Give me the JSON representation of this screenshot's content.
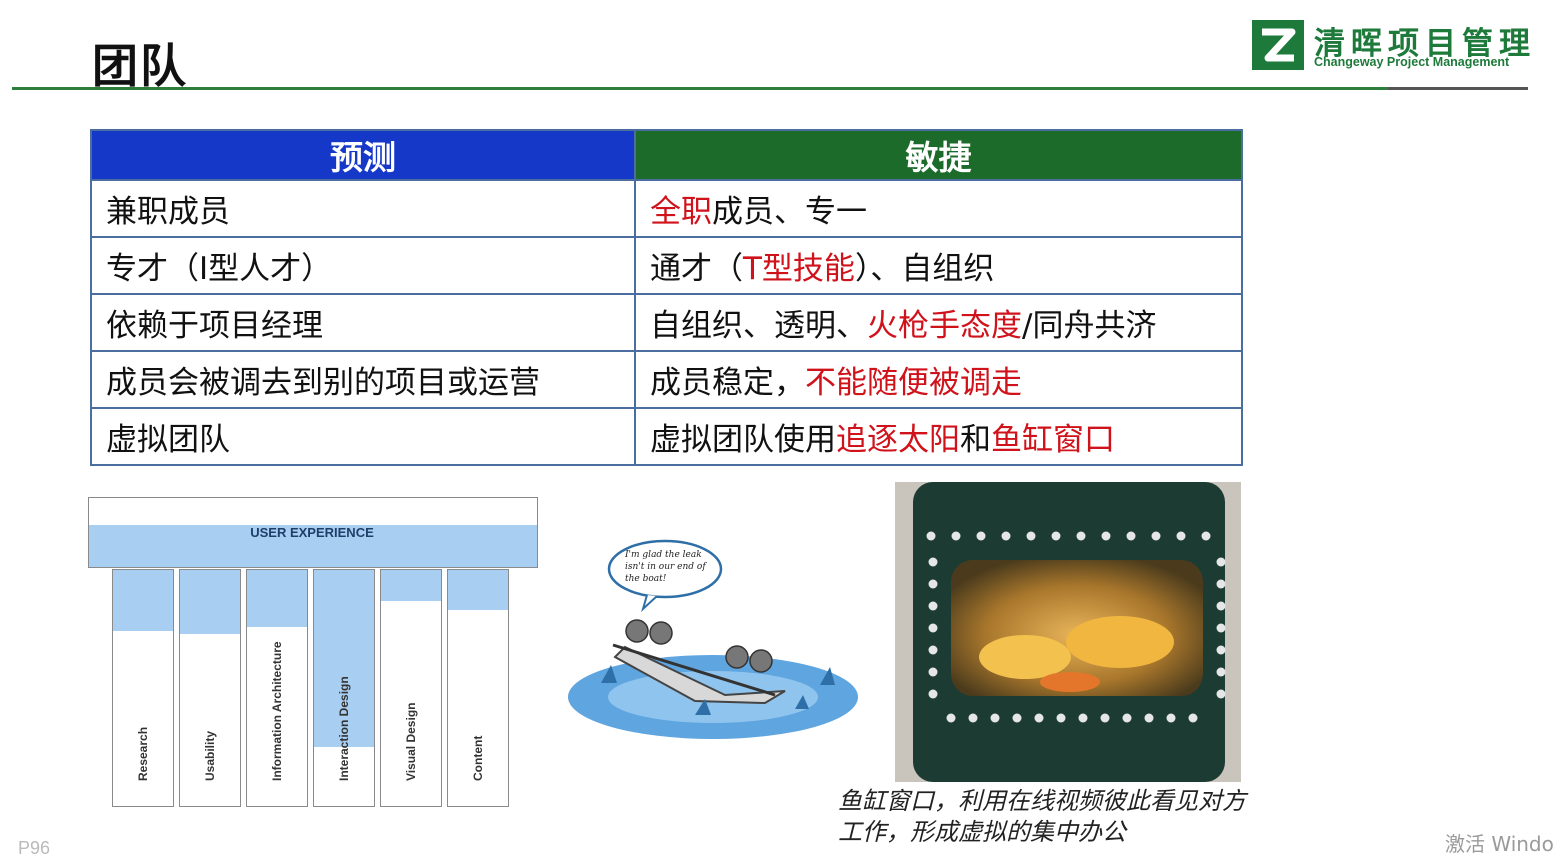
{
  "slide": {
    "title": "团队",
    "page_number": "P96",
    "watermark": "激活 Windo"
  },
  "logo": {
    "name_cn": "清晖项目管理",
    "name_en": "Changeway Project Management",
    "brand_color": "#1d7a3a"
  },
  "table": {
    "headers": [
      "预测",
      "敏捷"
    ],
    "header_colors": [
      "#1538c8",
      "#1d6b2b"
    ],
    "highlight_color": "#d0121b",
    "rows": [
      {
        "predictive": "兼职成员",
        "agile": [
          {
            "text": "全职",
            "highlight": true
          },
          {
            "text": "成员、专一",
            "highlight": false
          }
        ]
      },
      {
        "predictive": "专才（I型人才）",
        "agile": [
          {
            "text": "通才（",
            "highlight": false
          },
          {
            "text": "T型技能",
            "highlight": true
          },
          {
            "text": "）、自组织",
            "highlight": false
          }
        ]
      },
      {
        "predictive": "依赖于项目经理",
        "agile": [
          {
            "text": "自组织、透明、",
            "highlight": false
          },
          {
            "text": "火枪手态度",
            "highlight": true
          },
          {
            "text": "/同舟共济",
            "highlight": false
          }
        ]
      },
      {
        "predictive": "成员会被调去到别的项目或运营",
        "agile": [
          {
            "text": "成员稳定，",
            "highlight": false
          },
          {
            "text": "不能随便被调走",
            "highlight": true
          }
        ]
      },
      {
        "predictive": "虚拟团队",
        "agile": [
          {
            "text": "虚拟团队使用",
            "highlight": false
          },
          {
            "text": "追逐太阳",
            "highlight": true
          },
          {
            "text": "和",
            "highlight": false
          },
          {
            "text": "鱼缸窗口",
            "highlight": true
          }
        ]
      }
    ]
  },
  "ux_diagram": {
    "title": "USER EXPERIENCE",
    "pillars": [
      {
        "label": "Research",
        "fill": 0.26
      },
      {
        "label": "Usability",
        "fill": 0.27
      },
      {
        "label": "Information Architecture",
        "fill": 0.24
      },
      {
        "label": "Interaction Design",
        "fill": 0.75
      },
      {
        "label": "Visual Design",
        "fill": 0.13
      },
      {
        "label": "Content",
        "fill": 0.17
      }
    ]
  },
  "cartoon": {
    "speech": "I'm glad the leak isn't in our end of the boat!"
  },
  "photo": {
    "caption": "鱼缸窗口，利用在线视频彼此看见对方工作，形成虚拟的集中办公"
  }
}
